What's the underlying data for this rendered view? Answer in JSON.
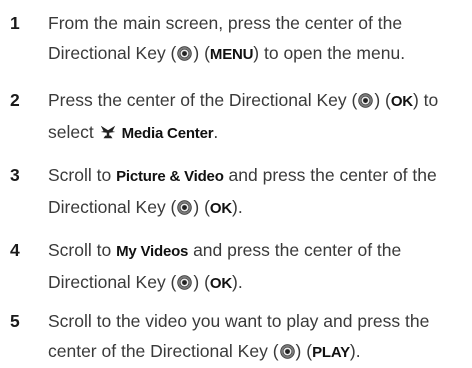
{
  "steps": [
    {
      "number": "1",
      "parts": {
        "a": "From the main screen, press the center of the",
        "b": "Directional Key (",
        "c": ") (",
        "key": "MENU",
        "d": ") to open the menu."
      }
    },
    {
      "number": "2",
      "parts": {
        "a": "Press the center of the Directional Key (",
        "b": ") (",
        "key": "OK",
        "c": ") to",
        "d": "select ",
        "menu": "Media Center",
        "e": "."
      }
    },
    {
      "number": "3",
      "parts": {
        "a": "Scroll to ",
        "item": "Picture & Video",
        "b": " and press the center of the",
        "c": "Directional Key (",
        "d": ") (",
        "key": "OK",
        "e": ")."
      }
    },
    {
      "number": "4",
      "parts": {
        "a": "Scroll to ",
        "item": "My Videos",
        "b": " and press the center of the",
        "c": "Directional Key (",
        "d": ") (",
        "key": "OK",
        "e": ")."
      }
    },
    {
      "number": "5",
      "parts": {
        "a": "Scroll to the video you want to play and press the",
        "b": "center of the Directional Key (",
        "c": ") (",
        "key": "PLAY",
        "d": ")."
      }
    }
  ],
  "icons": {
    "directional_key": "directional-key-icon",
    "media_center": "media-center-icon"
  }
}
